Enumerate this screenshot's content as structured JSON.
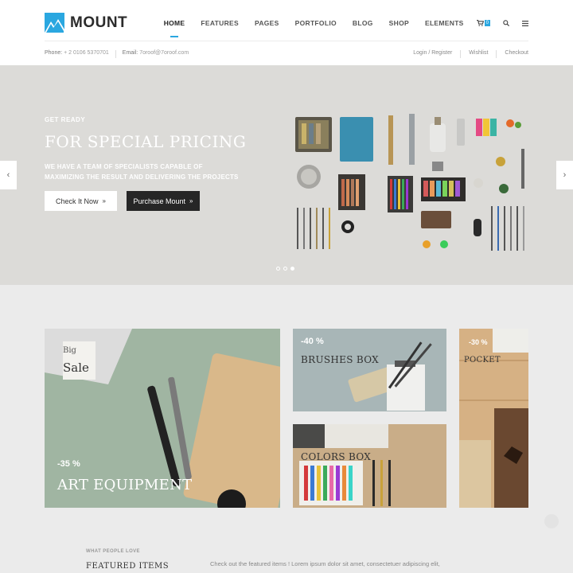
{
  "brand": {
    "name": "MOUNT",
    "accent": "#2aa7e0"
  },
  "nav": {
    "items": [
      {
        "label": "HOME"
      },
      {
        "label": "FEATURES"
      },
      {
        "label": "PAGES"
      },
      {
        "label": "PORTFOLIO"
      },
      {
        "label": "BLOG"
      },
      {
        "label": "SHOP"
      },
      {
        "label": "ELEMENTS"
      }
    ],
    "active": "HOME",
    "cart_count": "0",
    "icons": [
      "cart-icon",
      "search-icon",
      "menu-icon"
    ]
  },
  "topbar": {
    "phone_label": "Phone:",
    "phone": "+ 2 0106 5370701",
    "email_label": "Email:",
    "email": "7oroof@7oroof.com",
    "links": [
      "Login / Register",
      "Wishlist",
      "Checkout"
    ]
  },
  "hero": {
    "kicker": "GET READY",
    "title": "FOR SPECIAL PRICING",
    "description": "WE HAVE A TEAM OF SPECIALISTS CAPABLE OF MAXIMIZING THE RESULT AND DELIVERING THE PROJECTS",
    "primary_button": "Check It Now",
    "secondary_button": "Purchase Mount",
    "slides": 3,
    "active_slide": 3
  },
  "promos": {
    "big": {
      "small": "Big",
      "large": "Sale",
      "discount": "-35 %",
      "name": "ART EQUIPMENT"
    },
    "brushes": {
      "discount": "-40 %",
      "name": "BRUSHES BOX"
    },
    "colors": {
      "name": "COLORS BOX"
    },
    "pocket": {
      "discount": "-30 %",
      "name": "POCKET"
    }
  },
  "featured": {
    "kicker": "WHAT PEOPLE LOVE",
    "title": "FEATURED ITEMS",
    "text": "Check out the featured items ! Lorem ipsum dolor sit amet, consectetuer adipiscing elit,"
  }
}
